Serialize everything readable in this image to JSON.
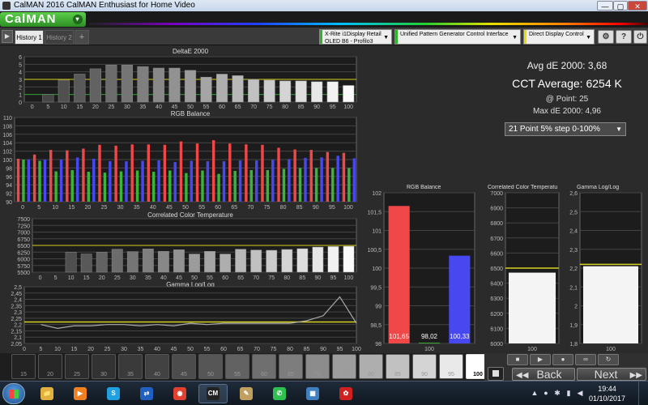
{
  "window": {
    "title": "CalMAN 2016 CalMAN Enthusiast for Home Video",
    "minimize": "—",
    "maximize": "▢",
    "close": "✕"
  },
  "logo": {
    "text": "CalMAN",
    "arrow": "▾"
  },
  "tabs": [
    {
      "label": "History 1",
      "active": true
    },
    {
      "label": "History 2",
      "active": false
    },
    {
      "label": "+",
      "active": false
    }
  ],
  "devices": [
    {
      "line1": "X-Rite i1Display Retail",
      "line2": "OLED B6 - Profilo3",
      "color": "#2fb52a"
    },
    {
      "line1": "Unified Pattern Generator Control Interface",
      "line2": "",
      "color": "#2fb52a"
    },
    {
      "line1": "Direct Display Control",
      "line2": "",
      "color": "#e8e000"
    }
  ],
  "toolbar": {
    "settings_icon": "⚙",
    "help_icon": "?",
    "power_icon": "⏻",
    "play_icon": "▶"
  },
  "stats": {
    "avg_de": "Avg dE 2000: 3,68",
    "cct_avg": "CCT Average: 6254 K",
    "at_point": "@ Point: 25",
    "max_de": "Max dE 2000: 4,96"
  },
  "step_select": {
    "value": "21 Point 5% step 0-100%",
    "arrow": "▼"
  },
  "colors": {
    "red": "#f04848",
    "green": "#3cb43c",
    "blue": "#4848f0",
    "yellow": "#d8d020",
    "grid": "#444444"
  },
  "chart_data": [
    {
      "id": "deltae",
      "type": "bar",
      "title": "DeltaE 2000",
      "categories": [
        "0",
        "5",
        "10",
        "15",
        "20",
        "25",
        "30",
        "35",
        "40",
        "45",
        "50",
        "55",
        "60",
        "65",
        "70",
        "75",
        "80",
        "85",
        "90",
        "95",
        "100"
      ],
      "values": [
        0,
        1,
        2.9,
        3.7,
        4.4,
        4.9,
        4.9,
        4.7,
        4.5,
        4.5,
        4.2,
        3.3,
        3.7,
        3.5,
        3.0,
        2.9,
        2.8,
        2.8,
        2.7,
        2.7,
        2.2
      ],
      "ylim": [
        0,
        6
      ],
      "yticks": [
        "0",
        "1",
        "2",
        "3",
        "4",
        "5",
        "6"
      ],
      "thresholds": [
        3,
        1
      ]
    },
    {
      "id": "rgbbalance",
      "type": "bar",
      "title": "RGB Balance",
      "categories": [
        "0",
        "5",
        "10",
        "15",
        "20",
        "25",
        "30",
        "35",
        "40",
        "45",
        "50",
        "55",
        "60",
        "65",
        "70",
        "75",
        "80",
        "85",
        "90",
        "95",
        "100"
      ],
      "series": [
        {
          "name": "R",
          "values": [
            100.2,
            101.2,
            102.3,
            102.2,
            102.6,
            103.5,
            103.3,
            103.6,
            103.6,
            103.5,
            104.3,
            103.8,
            104.6,
            103.8,
            103.6,
            103.5,
            102.8,
            102.4,
            102.3,
            101.8,
            101.6
          ]
        },
        {
          "name": "G",
          "values": [
            100.0,
            99.7,
            97.2,
            97.5,
            97.1,
            96.9,
            97.2,
            97.4,
            97.1,
            97.4,
            96.8,
            97.4,
            96.6,
            97.3,
            97.5,
            97.5,
            97.8,
            98.0,
            98.0,
            98.0,
            98.0
          ]
        },
        {
          "name": "B",
          "values": [
            100.0,
            100.0,
            100.0,
            100.5,
            100.2,
            99.6,
            99.6,
            99.7,
            99.8,
            99.4,
            99.7,
            99.6,
            99.6,
            99.8,
            99.8,
            100.0,
            100.1,
            100.4,
            100.5,
            100.9,
            100.3
          ]
        }
      ],
      "ylim": [
        90,
        110
      ],
      "yticks": [
        "90",
        "92",
        "94",
        "96",
        "98",
        "100",
        "102",
        "104",
        "106",
        "108",
        "110"
      ]
    },
    {
      "id": "cct",
      "type": "bar",
      "title": "Correlated Color Temperature",
      "categories": [
        "0",
        "5",
        "10",
        "15",
        "20",
        "25",
        "30",
        "35",
        "40",
        "45",
        "50",
        "55",
        "60",
        "65",
        "70",
        "75",
        "80",
        "85",
        "90",
        "95",
        "100"
      ],
      "values": [
        null,
        null,
        6250,
        6180,
        6250,
        6360,
        6270,
        6370,
        6280,
        6340,
        6180,
        6280,
        6180,
        6360,
        6330,
        6320,
        6350,
        6380,
        6440,
        6460,
        6470
      ],
      "ylim": [
        5500,
        7500
      ],
      "yticks": [
        "5500",
        "5750",
        "6000",
        "6250",
        "6500",
        "6750",
        "7000",
        "7250",
        "7500"
      ],
      "target": 6500
    },
    {
      "id": "gamma",
      "type": "line",
      "title": "Gamma Log/Log",
      "x": [
        5,
        10,
        15,
        20,
        25,
        30,
        35,
        40,
        45,
        50,
        55,
        60,
        65,
        70,
        75,
        80,
        85,
        90,
        95,
        100
      ],
      "values": [
        2.2,
        2.17,
        2.19,
        2.19,
        2.2,
        2.2,
        2.19,
        2.2,
        2.19,
        2.21,
        2.2,
        2.21,
        2.21,
        2.21,
        2.21,
        2.21,
        2.23,
        2.27,
        2.42,
        2.21
      ],
      "target": 2.22,
      "ylim": [
        2.05,
        2.5
      ],
      "yticks": [
        "2,05",
        "2,1",
        "2,15",
        "2,2",
        "2,25",
        "2,3",
        "2,35",
        "2,4",
        "2,45",
        "2,5"
      ],
      "xticks": [
        "0",
        "5",
        "10",
        "15",
        "20",
        "25",
        "30",
        "35",
        "40",
        "45",
        "50",
        "55",
        "60",
        "65",
        "70",
        "75",
        "80",
        "85",
        "90",
        "95",
        "100"
      ]
    },
    {
      "id": "rgbpoint",
      "type": "bar",
      "title": "RGB Balance",
      "categories": [
        "100"
      ],
      "values": [
        101.65,
        98.02,
        100.33
      ],
      "labels": [
        "101,65",
        "98,02",
        "100,33"
      ],
      "ylim": [
        98,
        102
      ],
      "yticks": [
        "98",
        "98,5",
        "99",
        "99,5",
        "100",
        "100,5",
        "101",
        "101,5",
        "102"
      ]
    },
    {
      "id": "cctpoint",
      "type": "bar",
      "title": "Correlated Color Temperatu",
      "categories": [
        "100"
      ],
      "values": [
        6470
      ],
      "target": 6500,
      "ylim": [
        6000,
        7000
      ],
      "yticks": [
        "6000",
        "6100",
        "6200",
        "6300",
        "6400",
        "6500",
        "6600",
        "6700",
        "6800",
        "6900",
        "7000"
      ]
    },
    {
      "id": "gammapoint",
      "type": "bar",
      "title": "Gamma Log/Log",
      "categories": [
        "100"
      ],
      "values": [
        2.21
      ],
      "target": 2.22,
      "ylim": [
        1.8,
        2.6
      ],
      "yticks": [
        "1,8",
        "1,9",
        "2",
        "2,1",
        "2,2",
        "2,3",
        "2,4",
        "2,5",
        "2,6"
      ]
    }
  ],
  "swatches": {
    "labels": [
      "15",
      "20",
      "25",
      "30",
      "35",
      "40",
      "45",
      "50",
      "55",
      "60",
      "65",
      "70",
      "75",
      "80",
      "85",
      "90",
      "95",
      "100"
    ],
    "levels": [
      0.15,
      0.2,
      0.25,
      0.3,
      0.35,
      0.4,
      0.45,
      0.5,
      0.55,
      0.6,
      0.65,
      0.7,
      0.75,
      0.8,
      0.85,
      0.9,
      0.95,
      1.0
    ],
    "selected": "100"
  },
  "controls": {
    "stop_icon": "■",
    "play_icon": "▶",
    "record_icon": "●",
    "loop_icon": "∞",
    "refresh_icon": "↻",
    "back": "Back",
    "next": "Next",
    "back_icon": "◀◀",
    "next_icon": "▶▶"
  },
  "taskbar": {
    "apps": [
      {
        "name": "explorer",
        "glyph": "📁",
        "color": "#e0b040"
      },
      {
        "name": "media",
        "glyph": "▶",
        "color": "#f08020"
      },
      {
        "name": "skype",
        "glyph": "S",
        "color": "#20a0e0"
      },
      {
        "name": "teamviewer",
        "glyph": "⇄",
        "color": "#2060c0"
      },
      {
        "name": "chrome",
        "glyph": "◉",
        "color": "#e04030"
      },
      {
        "name": "calman",
        "glyph": "CM",
        "color": "#222222"
      },
      {
        "name": "paint",
        "glyph": "✎",
        "color": "#c0a060"
      },
      {
        "name": "whatsapp",
        "glyph": "✆",
        "color": "#30c050"
      },
      {
        "name": "network",
        "glyph": "▦",
        "color": "#4080c0"
      },
      {
        "name": "app",
        "glyph": "✿",
        "color": "#d02020"
      }
    ],
    "clock_time": "19:44",
    "clock_date": "01/10/2017"
  }
}
